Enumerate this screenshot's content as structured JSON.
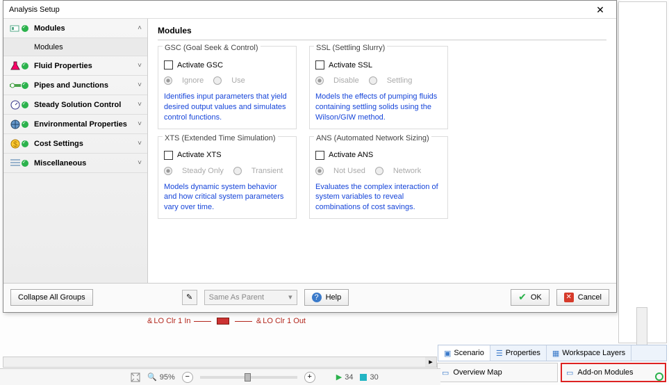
{
  "dialog": {
    "title": "Analysis Setup",
    "sidebar": {
      "groups": [
        {
          "label": "Modules",
          "expanded": true,
          "sub": "Modules"
        },
        {
          "label": "Fluid Properties"
        },
        {
          "label": "Pipes and Junctions"
        },
        {
          "label": "Steady Solution Control"
        },
        {
          "label": "Environmental Properties"
        },
        {
          "label": "Cost Settings"
        },
        {
          "label": "Miscellaneous"
        }
      ]
    },
    "content": {
      "header": "Modules",
      "modules": [
        {
          "title": "GSC (Goal Seek & Control)",
          "activate": "Activate GSC",
          "radios": [
            "Ignore",
            "Use"
          ],
          "desc": "Identifies input parameters that yield desired output values and simulates control functions."
        },
        {
          "title": "SSL (Settling Slurry)",
          "activate": "Activate SSL",
          "radios": [
            "Disable",
            "Settling"
          ],
          "desc": "Models the effects of pumping fluids containing settling solids using the Wilson/GIW method."
        },
        {
          "title": "XTS (Extended Time Simulation)",
          "activate": "Activate XTS",
          "radios": [
            "Steady Only",
            "Transient"
          ],
          "desc": "Models dynamic system behavior and how critical system parameters vary over time."
        },
        {
          "title": "ANS (Automated Network Sizing)",
          "activate": "Activate ANS",
          "radios": [
            "Not Used",
            "Network"
          ],
          "desc": "Evaluates the complex interaction of system variables to reveal combinations of cost savings."
        }
      ]
    },
    "footer": {
      "collapse": "Collapse All Groups",
      "same_as_parent": "Same As Parent",
      "help": "Help",
      "ok": "OK",
      "cancel": "Cancel"
    }
  },
  "diagram": {
    "in": "LO Clr 1 In",
    "out": "LO Clr 1 Out",
    "amp": "&"
  },
  "tabs": {
    "scenario": "Scenario",
    "properties": "Properties",
    "layers": "Workspace Layers"
  },
  "panels": {
    "overview": "Overview Map",
    "addon": "Add-on Modules"
  },
  "status": {
    "zoom_pct": "95%",
    "n_play": "34",
    "n_sq": "30"
  }
}
